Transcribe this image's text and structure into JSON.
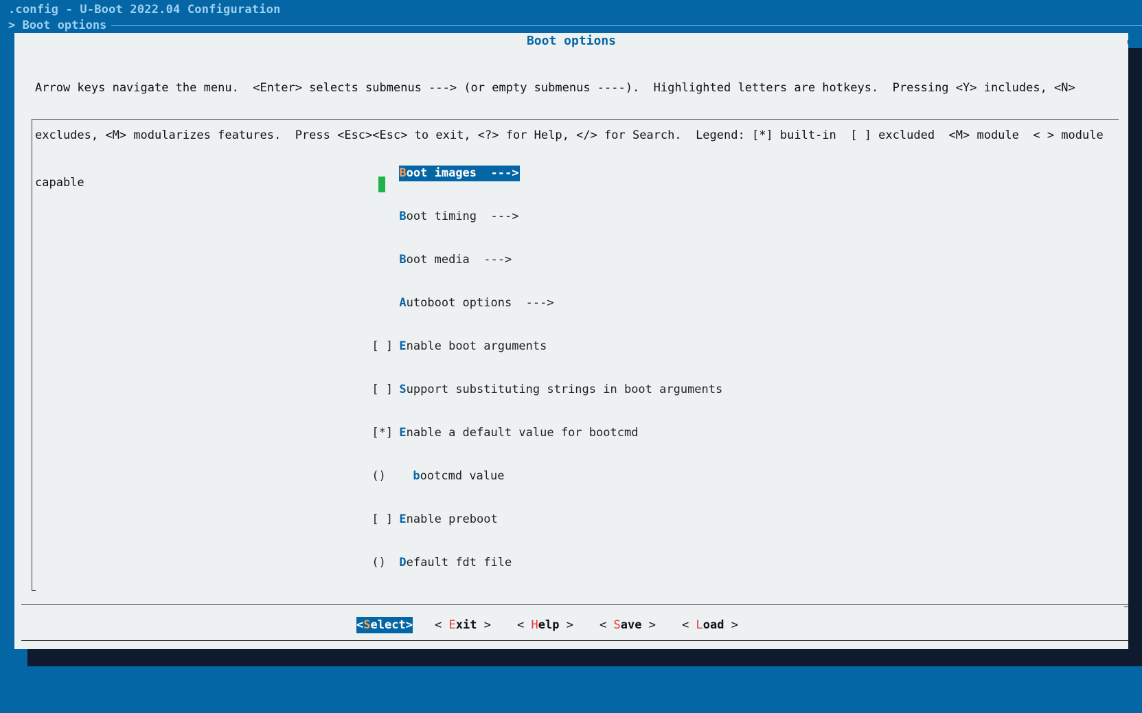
{
  "window": {
    "title": ".config - U-Boot 2022.04 Configuration",
    "breadcrumb": "> Boot options"
  },
  "dialog": {
    "title": "Boot options",
    "help_lines": [
      "Arrow keys navigate the menu.  <Enter> selects submenus ---> (or empty submenus ----).  Highlighted letters are hotkeys.  Pressing <Y> includes, <N>",
      "excludes, <M> modularizes features.  Press <Esc><Esc> to exit, <?> for Help, </> for Search.  Legend: [*] built-in  [ ] excluded  <M> module  < > module",
      "capable"
    ]
  },
  "menu": {
    "items": [
      {
        "prefix": "",
        "hotkey": "B",
        "rest": "oot images  --->",
        "indent": false,
        "selected": true
      },
      {
        "prefix": "",
        "hotkey": "B",
        "rest": "oot timing  --->",
        "indent": false,
        "selected": false
      },
      {
        "prefix": "",
        "hotkey": "B",
        "rest": "oot media  --->",
        "indent": false,
        "selected": false
      },
      {
        "prefix": "",
        "hotkey": "A",
        "rest": "utoboot options  --->",
        "indent": false,
        "selected": false
      },
      {
        "prefix": "[ ]",
        "hotkey": "E",
        "rest": "nable boot arguments",
        "indent": false,
        "selected": false
      },
      {
        "prefix": "[ ]",
        "hotkey": "S",
        "rest": "upport substituting strings in boot arguments",
        "indent": false,
        "selected": false
      },
      {
        "prefix": "[*]",
        "hotkey": "E",
        "rest": "nable a default value for bootcmd",
        "indent": false,
        "selected": false
      },
      {
        "prefix": "()",
        "hotkey": "b",
        "rest": "ootcmd value",
        "indent": true,
        "selected": false
      },
      {
        "prefix": "[ ]",
        "hotkey": "E",
        "rest": "nable preboot",
        "indent": false,
        "selected": false
      },
      {
        "prefix": "()",
        "hotkey": "D",
        "rest": "efault fdt file",
        "indent": false,
        "selected": false
      }
    ]
  },
  "buttons": {
    "select": {
      "open": "<",
      "hotkey": "S",
      "rest": "elect",
      "close": ">"
    },
    "exit": {
      "open": "< ",
      "hotkey": "E",
      "rest": "xit",
      "close": " >"
    },
    "help": {
      "open": "< ",
      "hotkey": "H",
      "rest": "elp",
      "close": " >"
    },
    "save": {
      "open": "< ",
      "hotkey": "S",
      "rest": "ave",
      "close": " >"
    },
    "load": {
      "open": "< ",
      "hotkey": "L",
      "rest": "oad",
      "close": " >"
    }
  },
  "colors": {
    "background": "#0566a6",
    "dialog": "#eef1f2",
    "highlight": "#0566a6",
    "hotkey_selected": "#f2a05a",
    "button_hotkey": "#e03a3a",
    "cursor": "#1fb24a"
  }
}
